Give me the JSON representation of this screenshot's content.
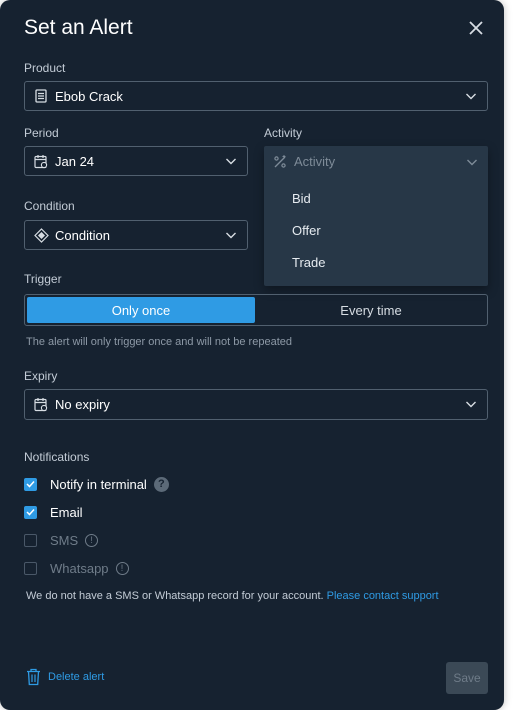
{
  "dialog": {
    "title": "Set an Alert",
    "close_icon": "close-icon"
  },
  "product": {
    "label": "Product",
    "value": "Ebob Crack",
    "icon": "product-icon"
  },
  "period": {
    "label": "Period",
    "value": "Jan 24",
    "icon": "calendar-icon"
  },
  "activity": {
    "label": "Activity",
    "placeholder": "Activity",
    "icon": "percent-icon",
    "options": [
      "Bid",
      "Offer",
      "Trade"
    ]
  },
  "condition": {
    "label": "Condition",
    "value": "Condition",
    "icon": "diamond-icon"
  },
  "trigger": {
    "label": "Trigger",
    "options": [
      "Only once",
      "Every time"
    ],
    "selected": "Only once",
    "hint": "The alert will only trigger once and will not be repeated"
  },
  "expiry": {
    "label": "Expiry",
    "value": "No expiry",
    "icon": "calendar-icon"
  },
  "notifications": {
    "label": "Notifications",
    "items": [
      {
        "label": "Notify in terminal",
        "checked": true,
        "suffix_icon": "help-icon"
      },
      {
        "label": "Email",
        "checked": true,
        "suffix_icon": ""
      },
      {
        "label": "SMS",
        "checked": false,
        "suffix_icon": "info-icon"
      },
      {
        "label": "Whatsapp",
        "checked": false,
        "suffix_icon": "info-icon"
      }
    ],
    "sms_note": "We do not have a SMS or Whatsapp record for your account.",
    "support_link": "Please contact support"
  },
  "footer": {
    "delete_label": "Delete alert",
    "save_label": "Save"
  },
  "colors": {
    "background": "#162230",
    "accent": "#2f9be4",
    "dropdown": "#273747"
  }
}
